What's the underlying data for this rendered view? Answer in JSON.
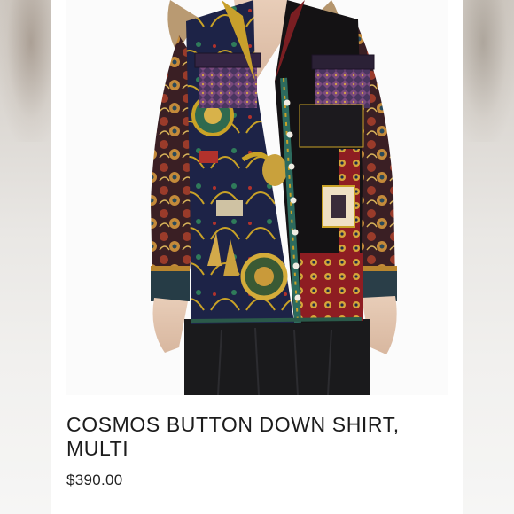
{
  "product": {
    "title": "COSMOS BUTTON DOWN SHIRT, MULTI",
    "price": "$390.00"
  },
  "image": {
    "subject": "patterned-silk-button-down-shirt",
    "colors": {
      "navy": "#1d2347",
      "black": "#141214",
      "gold": "#c9a227",
      "red": "#8e1d22",
      "purple": "#5a3a6e",
      "teal": "#2d6b5e",
      "skin": "#e2c6b0",
      "hair": "#b99a72"
    }
  }
}
